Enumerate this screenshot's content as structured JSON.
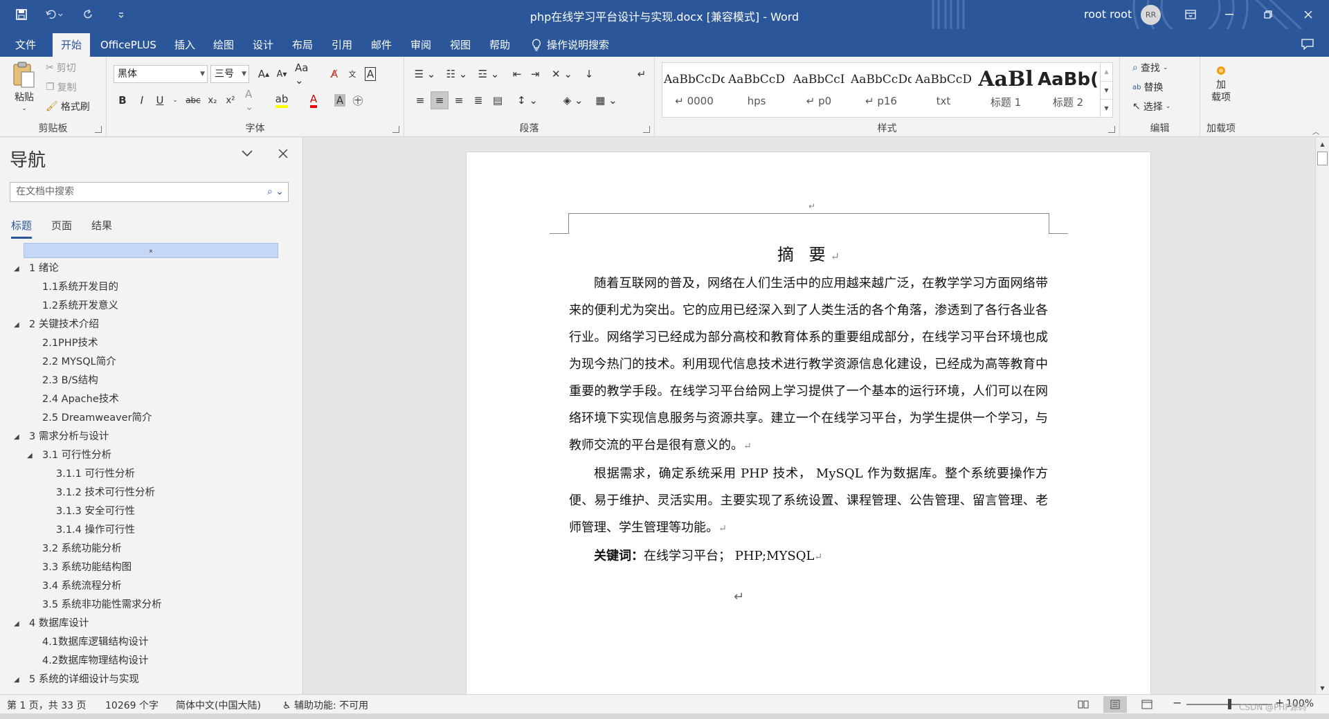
{
  "window": {
    "title": "php在线学习平台设计与实现.docx [兼容模式]  -  Word",
    "user_name": "root root",
    "user_initials": "RR"
  },
  "menu": {
    "tabs": [
      "文件",
      "开始",
      "OfficePLUS",
      "插入",
      "绘图",
      "设计",
      "布局",
      "引用",
      "邮件",
      "审阅",
      "视图",
      "帮助"
    ],
    "active_tab": "开始",
    "tell_me": "操作说明搜索"
  },
  "ribbon": {
    "clipboard": {
      "label": "剪贴板",
      "paste": "粘贴",
      "cut": "剪切",
      "copy": "复制",
      "format_painter": "格式刷"
    },
    "font": {
      "label": "字体",
      "font_name": "黑体",
      "font_size": "三号"
    },
    "paragraph": {
      "label": "段落"
    },
    "styles": {
      "label": "样式",
      "items": [
        {
          "preview": "AaBbCcDd",
          "name": "↵ 0000"
        },
        {
          "preview": "AaBbCcD",
          "name": "hps"
        },
        {
          "preview": "AaBbCcI",
          "name": "↵ p0"
        },
        {
          "preview": "AaBbCcDd",
          "name": "↵ p16"
        },
        {
          "preview": "AaBbCcD",
          "name": "txt"
        },
        {
          "preview": "AaBl",
          "name": "标题 1"
        },
        {
          "preview": "AaBb(",
          "name": "标题 2"
        }
      ]
    },
    "editing": {
      "label": "编辑",
      "find": "查找",
      "replace": "替换",
      "select": "选择"
    },
    "addins": {
      "label": "加载项",
      "button": "加\n载项"
    }
  },
  "nav": {
    "title": "导航",
    "search_placeholder": "在文档中搜索",
    "tabs": [
      "标题",
      "页面",
      "结果"
    ],
    "active_tab": "标题",
    "items": [
      {
        "text": "1 绪论",
        "level": 1,
        "expandable": true
      },
      {
        "text": "1.1系统开发目的",
        "level": 2,
        "expandable": false
      },
      {
        "text": "1.2系统开发意义",
        "level": 2,
        "expandable": false
      },
      {
        "text": "2 关键技术介绍",
        "level": 1,
        "expandable": true
      },
      {
        "text": "2.1PHP技术",
        "level": 2,
        "expandable": false
      },
      {
        "text": "2.2 MYSQL简介",
        "level": 2,
        "expandable": false
      },
      {
        "text": "2.3 B/S结构",
        "level": 2,
        "expandable": false
      },
      {
        "text": "2.4 Apache技术",
        "level": 2,
        "expandable": false
      },
      {
        "text": "2.5 Dreamweaver简介",
        "level": 2,
        "expandable": false
      },
      {
        "text": "3 需求分析与设计",
        "level": 1,
        "expandable": true
      },
      {
        "text": "3.1 可行性分析",
        "level": 2,
        "expandable": true
      },
      {
        "text": "3.1.1 可行性分析",
        "level": 3,
        "expandable": false
      },
      {
        "text": "3.1.2 技术可行性分析",
        "level": 3,
        "expandable": false
      },
      {
        "text": "3.1.3 安全可行性",
        "level": 3,
        "expandable": false
      },
      {
        "text": "3.1.4 操作可行性",
        "level": 3,
        "expandable": false
      },
      {
        "text": "3.2 系统功能分析",
        "level": 2,
        "expandable": false
      },
      {
        "text": "3.3 系统功能结构图",
        "level": 2,
        "expandable": false
      },
      {
        "text": "3.4 系统流程分析",
        "level": 2,
        "expandable": false
      },
      {
        "text": "3.5 系统非功能性需求分析",
        "level": 2,
        "expandable": false
      },
      {
        "text": "4 数据库设计",
        "level": 1,
        "expandable": true
      },
      {
        "text": "4.1数据库逻辑结构设计",
        "level": 2,
        "expandable": false
      },
      {
        "text": "4.2数据库物理结构设计",
        "level": 2,
        "expandable": false
      },
      {
        "text": "5 系统的详细设计与实现",
        "level": 1,
        "expandable": true
      }
    ]
  },
  "document": {
    "heading": "摘 要",
    "paragraphs": [
      "随着互联网的普及，网络在人们生活中的应用越来越广泛，在教学学习方面网络带来的便利尤为突出。它的应用已经深入到了人类生活的各个角落，渗透到了各行各业各行业。网络学习已经成为部分高校和教育体系的重要组成部分，在线学习平台环境也成为现今热门的技术。利用现代信息技术进行教学资源信息化建设，已经成为高等教育中重要的教学手段。在线学习平台给网上学习提供了一个基本的运行环境，人们可以在网络环境下实现信息服务与资源共享。建立一个在线学习平台，为学生提供一个学习，与教师交流的平台是很有意义的。",
      "根据需求，确定系统采用 PHP 技术， MySQL 作为数据库。整个系统要操作方便、易于维护、灵活实用。主要实现了系统设置、课程管理、公告管理、留言管理、老师管理、学生管理等功能。"
    ],
    "keywords_label": "关键词：",
    "keywords_value": "在线学习平台； PHP;MYSQL",
    "para_mark": "↵"
  },
  "status": {
    "page": "第 1 页，共 33 页",
    "words": "10269 个字",
    "language": "简体中文(中国大陆)",
    "accessibility": "辅助功能: 不可用",
    "zoom": "100%",
    "watermark": "CSDN @PHP源码"
  },
  "colors": {
    "accent": "#2b579a",
    "nav_selection": "#c5d7f4"
  }
}
